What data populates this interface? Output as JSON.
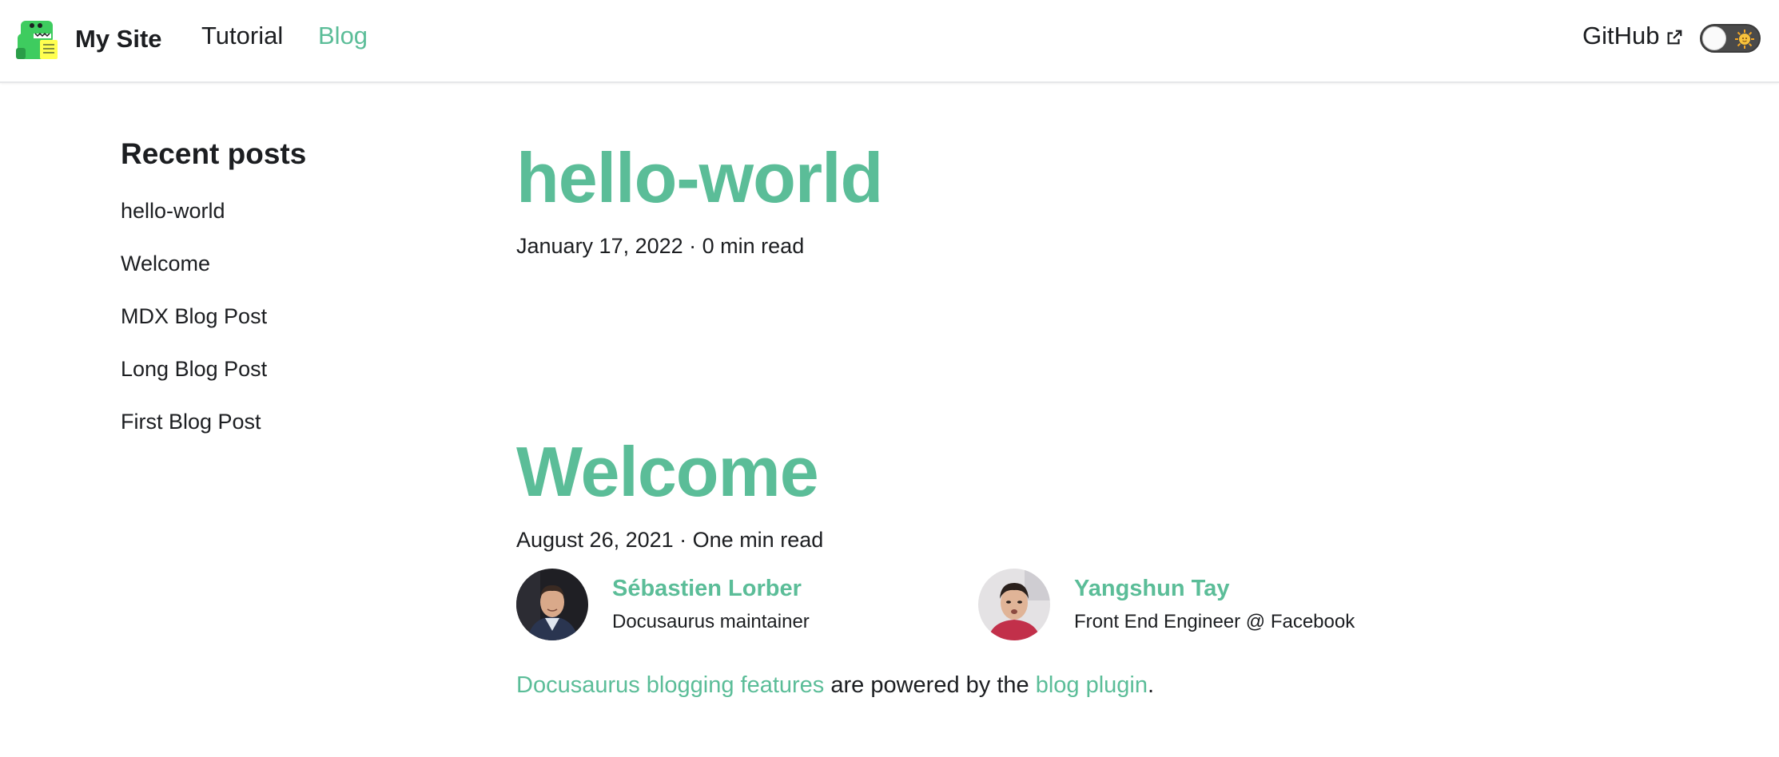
{
  "navbar": {
    "brand_title": "My Site",
    "links": [
      {
        "label": "Tutorial",
        "active": false
      },
      {
        "label": "Blog",
        "active": true
      }
    ],
    "github_label": "GitHub",
    "theme_toggle": "dark-mode-toggle"
  },
  "colors": {
    "accent": "#5bbd98",
    "text": "#1c1e21"
  },
  "sidebar": {
    "title": "Recent posts",
    "items": [
      {
        "label": "hello-world"
      },
      {
        "label": "Welcome"
      },
      {
        "label": "MDX Blog Post"
      },
      {
        "label": "Long Blog Post"
      },
      {
        "label": "First Blog Post"
      }
    ]
  },
  "posts": [
    {
      "title": "hello-world",
      "meta": "January 17, 2022 · 0 min read"
    },
    {
      "title": "Welcome",
      "meta": "August 26, 2021 · One min read",
      "authors": [
        {
          "name": "Sébastien Lorber",
          "title": "Docusaurus maintainer",
          "avatar_icon": "avatar-sebastien"
        },
        {
          "name": "Yangshun Tay",
          "title": "Front End Engineer @ Facebook",
          "avatar_icon": "avatar-yangshun"
        }
      ],
      "body": {
        "link1": "Docusaurus blogging features",
        "text1": " are powered by the ",
        "link2": "blog plugin",
        "text2": "."
      }
    }
  ]
}
